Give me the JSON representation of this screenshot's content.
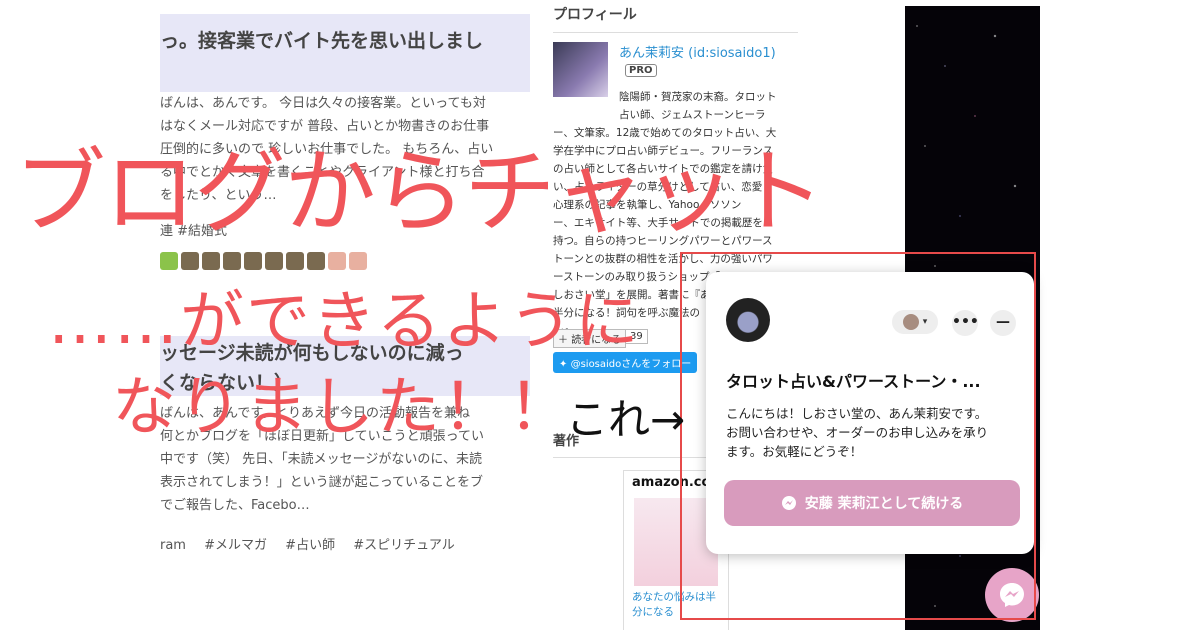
{
  "left": {
    "post1_title": "っ。接客業でバイト先を思い出しまし",
    "post1_excerpt": [
      "ばんは、あんです。 今日は久々の接客業。といっても対",
      "はなくメール対応ですが 普段、占いとか物書きのお仕事",
      "圧倒的に多いので 珍しいお仕事でした。 もちろん、占い",
      "る中でとかく文章を書くことやクライアント様と打ち合",
      "をしたり、という…"
    ],
    "post1_tag": "連 #結婚式",
    "post2_title": [
      "ッセージ未読が何もしないのに減っ",
      "くならない！）"
    ],
    "post2_excerpt": [
      "ばんは、あんです。とりあえず今日の活動報告を兼ね",
      "何とかブログを「ほぼ日更新」していこうと頑張ってい",
      "中です（笑） 先日、「未読メッセージがないのに、未読",
      "表示されてしまう！」という謎が起こっていることをブ",
      "でご報告した、Facebo…"
    ],
    "post2_tags": [
      "ram",
      "#メルマガ",
      "#占い師",
      "#スピリチュアル"
    ]
  },
  "sidebar": {
    "heading": "プロフィール",
    "name": "あん茉莉安 (id:siosaido1)",
    "badge": "PRO",
    "bio": [
      "陰陽師・賀茂家の末裔。タロット",
      "占い師、ジェムストーンヒーラ",
      "ー、文筆家。12歳で始めてのタロット占い、大",
      "学在学中にプロ占い師デビュー。フリーランス",
      "の占い師として各占いサイトでの鑑定を請け負",
      "い、占いライターの草分けとして占い、恋愛",
      "心理系の記事を執筆し、Yahoo、ソソン",
      "ー、エキサイト等、大手サイトでの掲載歴を",
      "持つ。自らの持つヒーリングパワーとパワース",
      "トーンとの抜群の相性を活かし、力の強いパワ",
      "ーストーンのみ取り扱うショップ「MagicStone",
      "しおさい堂」を展開。著書に『あなたの悩みは",
      "半分になる！詞句を呼ぶ魔法の",
      "ン』。"
    ],
    "reader_button": "読者になる",
    "reader_count": "39",
    "twitter_button": "@siosaidoさんをフォロー",
    "books_heading": "著作",
    "amazon_logo": "amazon.co",
    "book_title": "あなたの悩みは半分になる"
  },
  "chat": {
    "title": "タロット占い&パワーストーン・...",
    "message": [
      "こんにちは！しおさい堂の、あん茉莉安です。",
      "お問い合わせや、オーダーのお申し込みを承り",
      "ます。お気軽にどうぞ！"
    ],
    "cta_label": "安藤 茉莉江として続ける",
    "more_label": "•••",
    "minimize_label": "—",
    "caret": "▾"
  },
  "overlay": {
    "line1": "ブログからチャット",
    "line2": "……ができるように",
    "line3": "なりました！！",
    "pointer_note": "これ→"
  },
  "colors": {
    "accent_red": "#f0555a",
    "messenger_pink": "#d89bbd",
    "title_band": "#e7e7f7",
    "link_blue": "#2a8fd0"
  }
}
